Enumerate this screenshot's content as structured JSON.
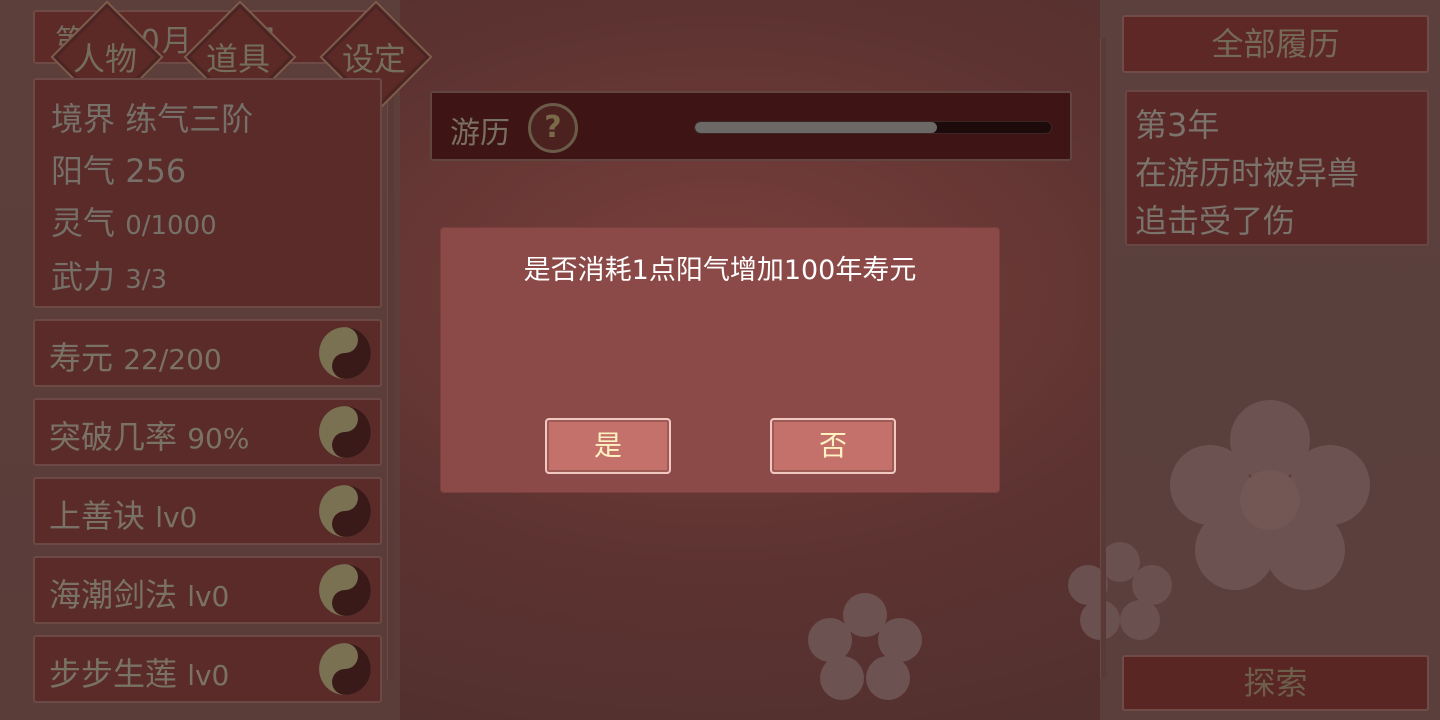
{
  "header": {
    "date_text": "第1 10月 10日"
  },
  "nav": {
    "character_label": "人物",
    "items_label": "道具",
    "settings_label": "设定"
  },
  "stats": {
    "realm_label": "境界",
    "realm_value": "练气三阶",
    "yang_label": "阳气",
    "yang_value": "256",
    "spirit_label": "灵气",
    "spirit_value": "0/1000",
    "force_label": "武力",
    "force_value": "3/3"
  },
  "rows": [
    {
      "label": "寿元",
      "value": "22/200",
      "icon": "yin-yang-icon"
    },
    {
      "label": "突破几率",
      "value": "90%",
      "icon": "yin-yang-icon"
    },
    {
      "label": "上善诀",
      "value": "lv0",
      "icon": "yin-yang-icon"
    },
    {
      "label": "海潮剑法",
      "value": "lv0",
      "icon": "yin-yang-icon"
    },
    {
      "label": "步步生莲",
      "value": "lv0",
      "icon": "yin-yang-icon"
    }
  ],
  "journey": {
    "label": "游历",
    "help_icon": "question-icon",
    "progress": 0.68
  },
  "history": {
    "all_history_label": "全部履历",
    "log": [
      "第3年",
      "在游历时被异兽",
      "追击受了伤"
    ],
    "explore_label": "探索"
  },
  "dialog": {
    "message": "是否消耗1点阳气增加100年寿元",
    "yes_label": "是",
    "no_label": "否"
  },
  "colors": {
    "dialog_bg": "#8b4a47",
    "button_bg": "#c4706b",
    "button_text": "#fff2c0"
  }
}
